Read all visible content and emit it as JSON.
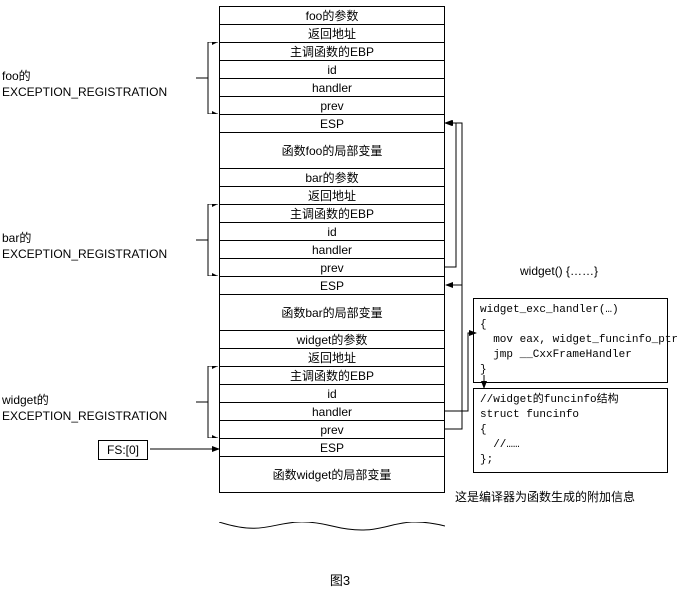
{
  "stack": {
    "cells": [
      "foo的参数",
      "返回地址",
      "主调函数的EBP",
      "id",
      "handler",
      "prev",
      "ESP",
      "函数foo的局部变量",
      "bar的参数",
      "返回地址",
      "主调函数的EBP",
      "id",
      "handler",
      "prev",
      "ESP",
      "函数bar的局部变量",
      "widget的参数",
      "返回地址",
      "主调函数的EBP",
      "id",
      "handler",
      "prev",
      "ESP",
      "函数widget的局部变量"
    ]
  },
  "labels": {
    "foo": {
      "l1": "foo的",
      "l2": "EXCEPTION_REGISTRATION"
    },
    "bar": {
      "l1": "bar的",
      "l2": "EXCEPTION_REGISTRATION"
    },
    "widget": {
      "l1": "widget的",
      "l2": "EXCEPTION_REGISTRATION"
    }
  },
  "fs": "FS:[0]",
  "right": {
    "widget_fn": "widget()    {……}",
    "handler_code": "widget_exc_handler(…)\n{\n  mov eax, widget_funcinfo_ptr\n  jmp __CxxFrameHandler\n}",
    "funcinfo_code": "//widget的funcinfo结构\nstruct funcinfo\n{\n  //……\n};",
    "note": "这是编译器为函数生成的附加信息"
  },
  "fig": "图3"
}
